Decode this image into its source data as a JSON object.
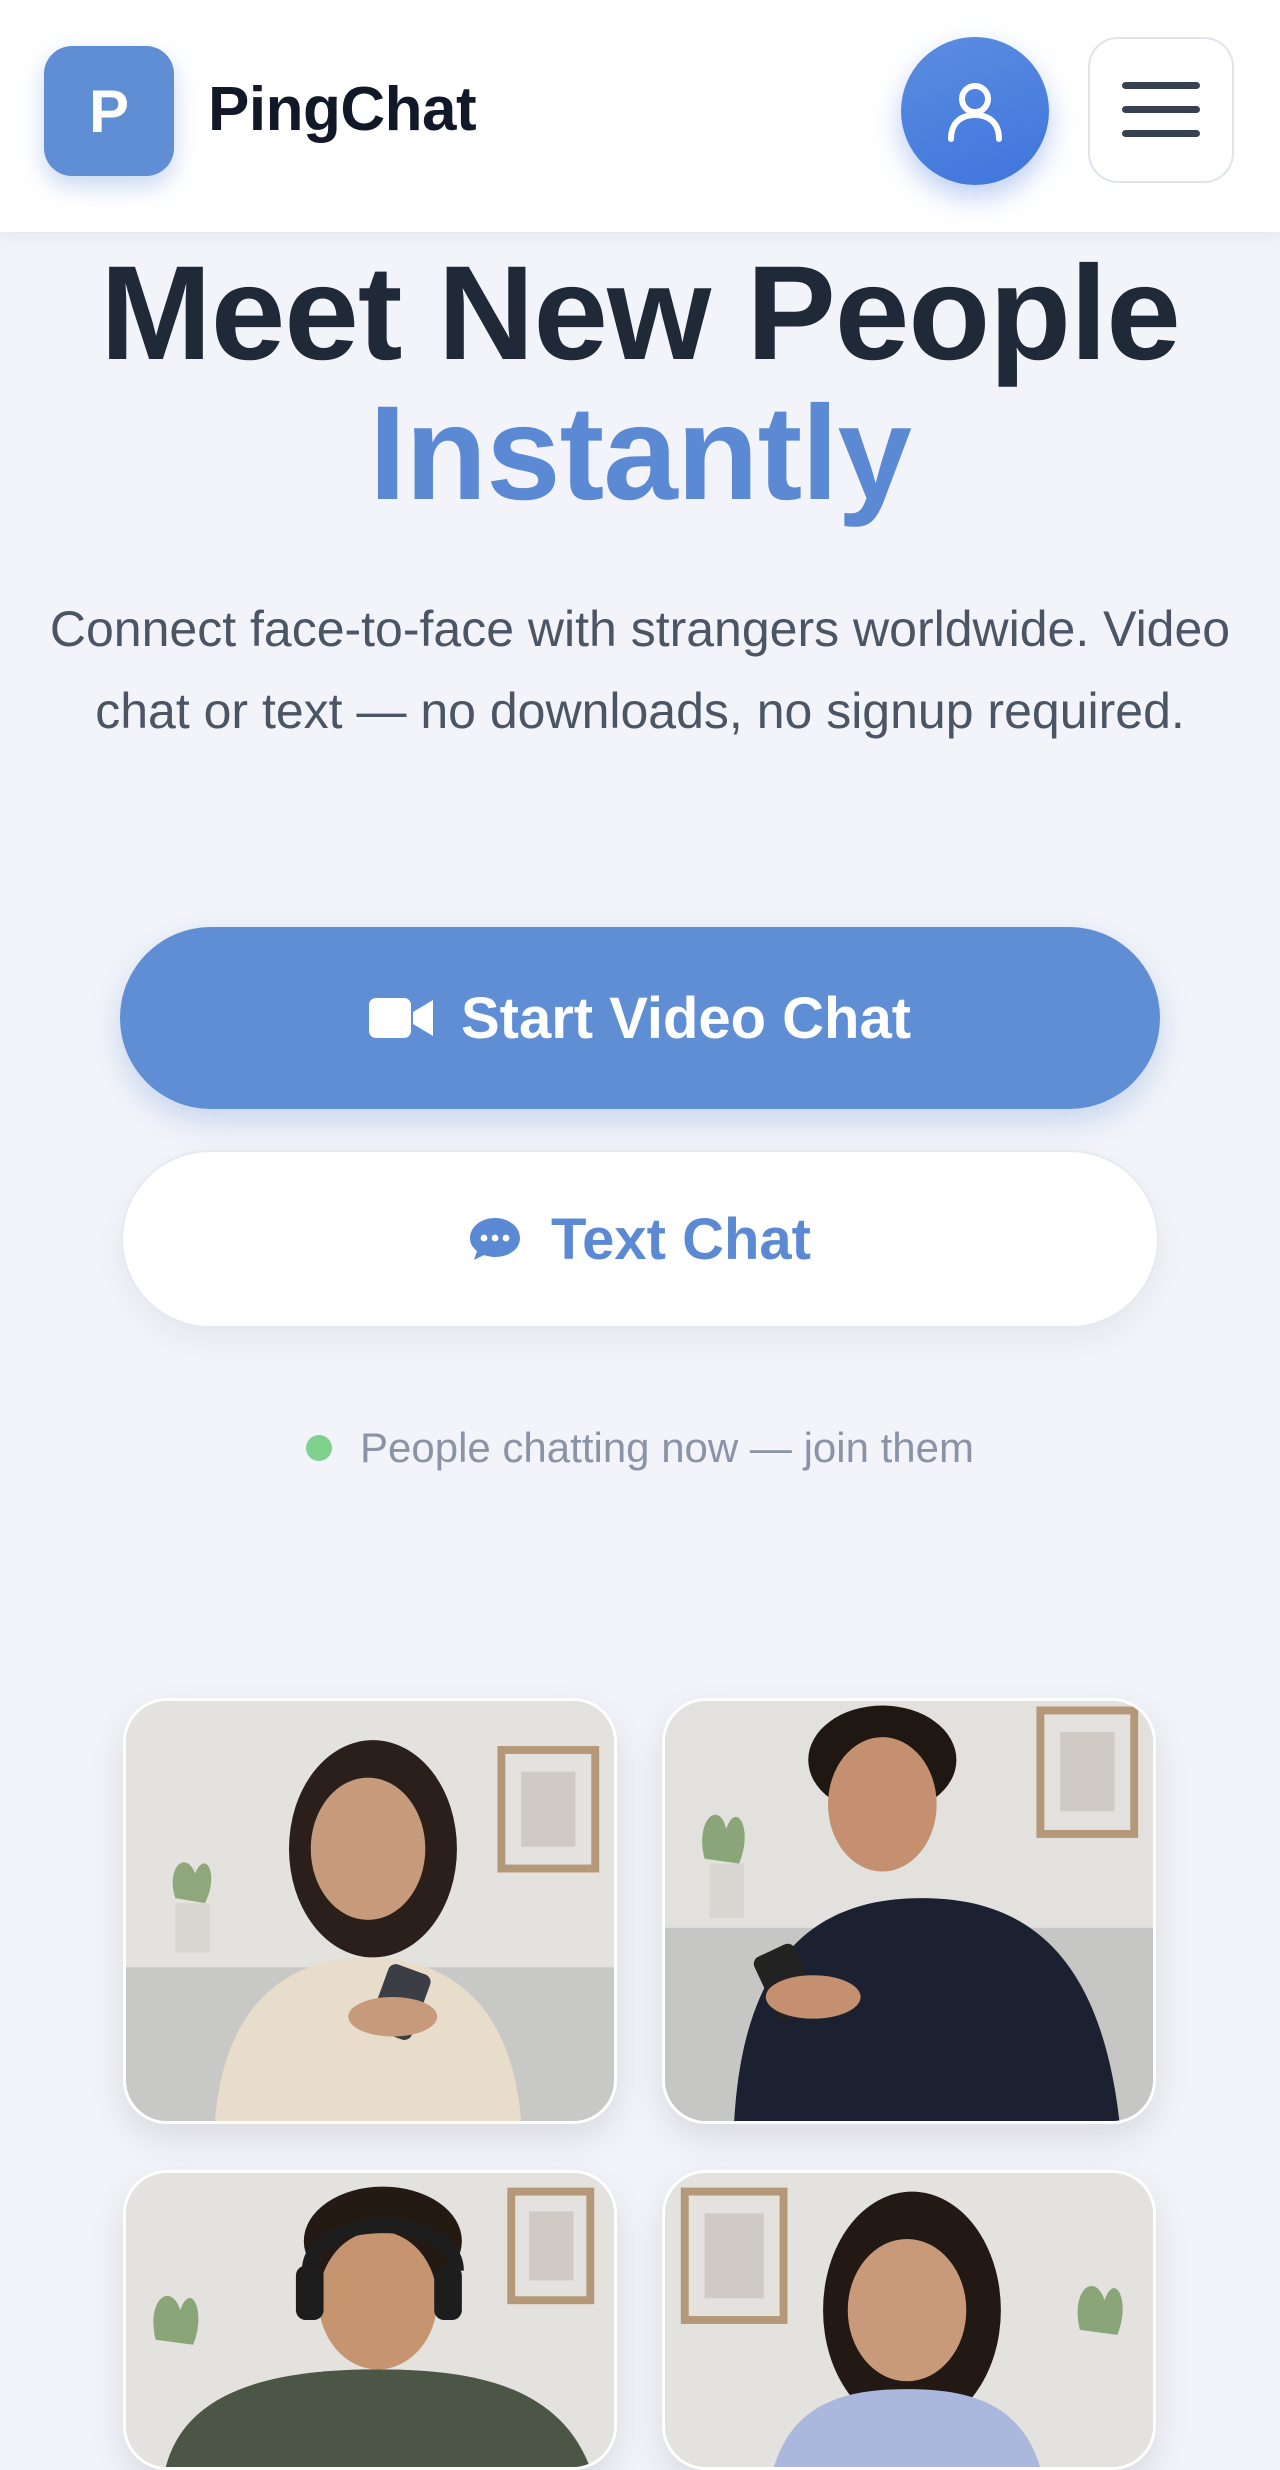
{
  "header": {
    "logo_letter": "P",
    "brand_name": "PingChat",
    "profile_icon": "user-icon",
    "menu_icon": "hamburger-menu-icon"
  },
  "hero": {
    "title_line1": "Meet New People",
    "title_line2": "Instantly",
    "subtitle": "Connect face-to-face with strangers worldwide. Video chat or text — no downloads, no signup required."
  },
  "actions": {
    "video_label": "Start Video Chat",
    "video_icon": "video-camera-icon",
    "text_label": "Text Chat",
    "text_icon": "chat-bubble-icon"
  },
  "status": {
    "text": "People chatting now — join them"
  },
  "colors": {
    "accent": "#5f8ed4",
    "title": "#1f2937",
    "online": "#7fd18f",
    "background": "#f2f4f9"
  },
  "gallery": [
    {
      "photo": "woman-smiling-at-phone"
    },
    {
      "photo": "man-in-hoodie-smiling-at-phone"
    },
    {
      "photo": "man-with-headphones"
    },
    {
      "photo": "woman-smiling-looking-down"
    }
  ]
}
